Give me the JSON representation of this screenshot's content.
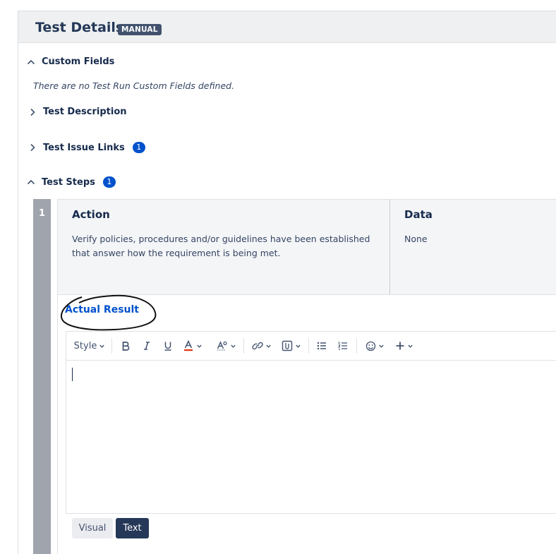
{
  "header": {
    "title": "Test Details",
    "badge": "MANUAL"
  },
  "sections": {
    "custom_fields": {
      "label": "Custom Fields",
      "expanded": true,
      "empty_note": "There are no Test Run Custom Fields defined."
    },
    "description": {
      "label": "Test Description",
      "expanded": false
    },
    "issue_links": {
      "label": "Test Issue Links",
      "expanded": false,
      "count": "1"
    },
    "steps": {
      "label": "Test Steps",
      "expanded": true,
      "count": "1"
    }
  },
  "step": {
    "number": "1",
    "action_header": "Action",
    "action_text": "Verify policies, procedures and/or guidelines have been established that answer how the requirement is being met.",
    "data_header": "Data",
    "data_text": "None",
    "actual_result_label": "Actual Result"
  },
  "toolbar": {
    "style_label": "Style",
    "buttons": [
      "bold-icon",
      "italic-icon",
      "underline-icon",
      "text-color-icon",
      "text-effects-icon",
      "link-icon",
      "attachment-icon",
      "bullet-list-icon",
      "numbered-list-icon",
      "emoji-icon",
      "insert-more-icon"
    ]
  },
  "editor": {
    "value": ""
  },
  "modes": {
    "visual": "Visual",
    "text": "Text",
    "active": "Text"
  },
  "colors": {
    "accent": "#0052cc",
    "header_bg": "#eef0f1",
    "dark_button": "#253858",
    "step_bar": "#a0a5ad",
    "text_color_underline": "#de350b"
  }
}
